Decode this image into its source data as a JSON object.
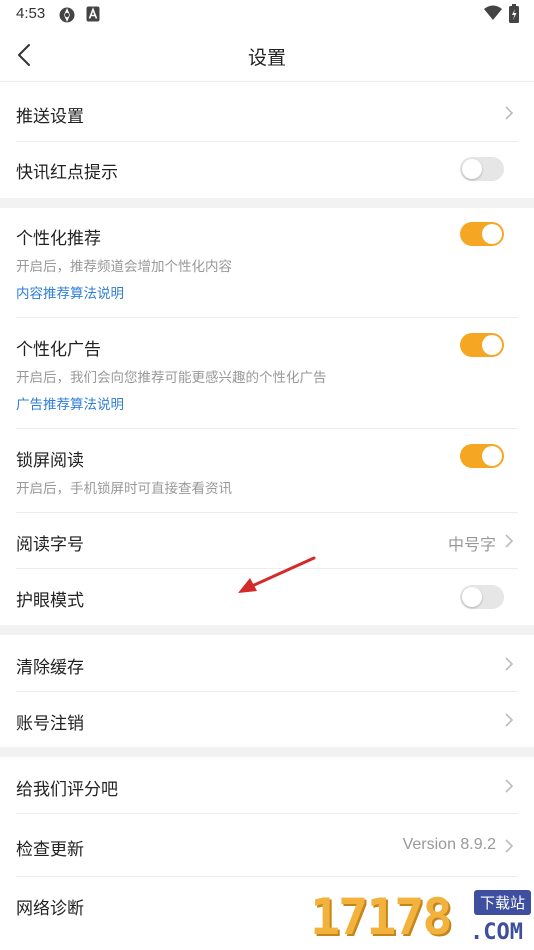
{
  "status_bar": {
    "time": "4:53",
    "icons": [
      "aperture-icon",
      "a-badge-icon",
      "wifi-icon",
      "battery-icon"
    ]
  },
  "nav": {
    "title": "设置",
    "back_icon": "chevron-left-icon"
  },
  "groups": [
    {
      "items": [
        {
          "label": "推送设置",
          "control": "chevron"
        },
        {
          "label": "快讯红点提示",
          "control": "toggle",
          "on": false
        }
      ]
    },
    {
      "items": [
        {
          "label": "个性化推荐",
          "subtitle": "开启后，推荐频道会增加个性化内容",
          "link": "内容推荐算法说明",
          "control": "toggle",
          "on": true
        },
        {
          "label": "个性化广告",
          "subtitle": "开启后，我们会向您推荐可能更感兴趣的个性化广告",
          "link": "广告推荐算法说明",
          "control": "toggle",
          "on": true
        },
        {
          "label": "锁屏阅读",
          "subtitle": "开启后，手机锁屏时可直接查看资讯",
          "control": "toggle",
          "on": true
        },
        {
          "label": "阅读字号",
          "value": "中号字",
          "control": "chevron"
        },
        {
          "label": "护眼模式",
          "control": "toggle",
          "on": false
        }
      ]
    },
    {
      "items": [
        {
          "label": "清除缓存",
          "control": "chevron"
        },
        {
          "label": "账号注销",
          "control": "chevron"
        }
      ]
    },
    {
      "items": [
        {
          "label": "给我们评分吧",
          "control": "chevron"
        },
        {
          "label": "检查更新",
          "value": "Version 8.9.2",
          "control": "chevron"
        },
        {
          "label": "网络诊断",
          "control": "chevron"
        }
      ]
    }
  ],
  "colors": {
    "toggle_on": "#f5a623",
    "toggle_off": "#e6e6e6",
    "link": "#2f7fd8",
    "annotation_arrow": "#d42a2a"
  },
  "watermark": {
    "digits": "17178",
    "badge": "下载站",
    "domain": ".COM"
  }
}
